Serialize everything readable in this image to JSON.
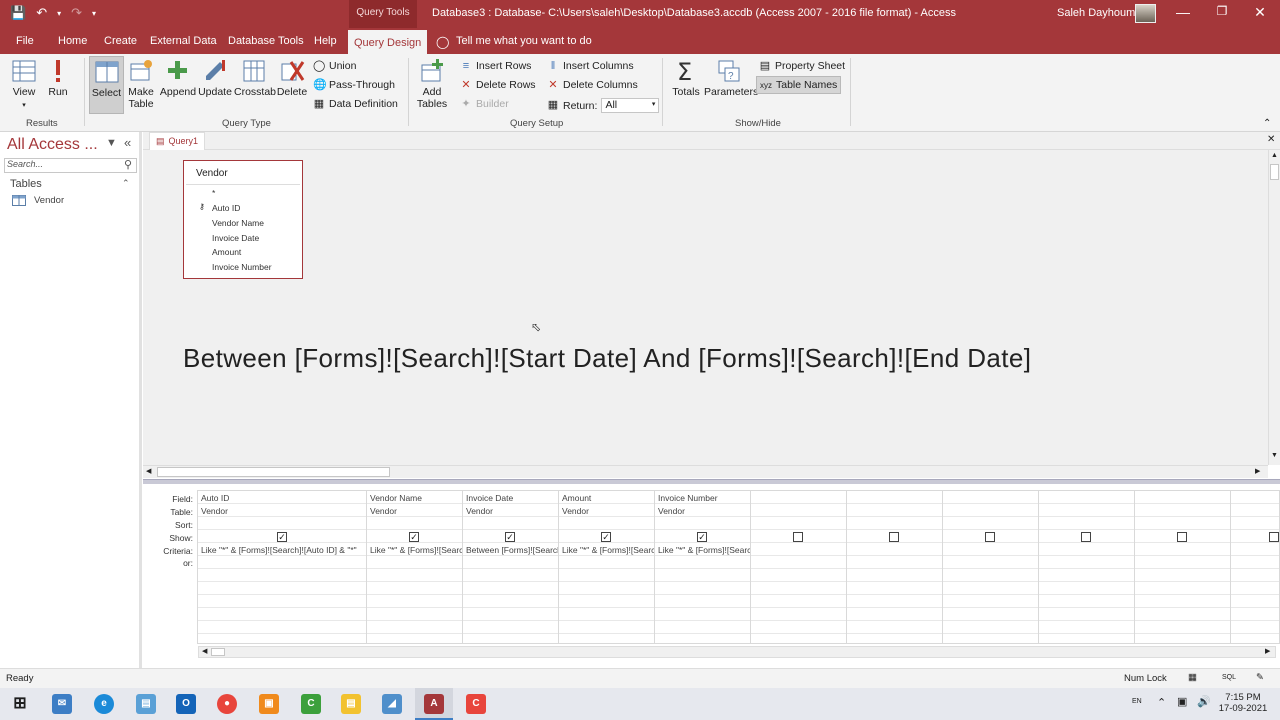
{
  "title_bar": {
    "context_tab": "Query Tools",
    "title": "Database3 : Database- C:\\Users\\saleh\\Desktop\\Database3.accdb (Access 2007 - 2016 file format)  -  Access",
    "user": "Saleh Dayhoum"
  },
  "tabs": [
    "File",
    "Home",
    "Create",
    "External Data",
    "Database Tools",
    "Help",
    "Query Design"
  ],
  "tell_me": "Tell me what you want to do",
  "ribbon": {
    "results": {
      "view": "View",
      "run": "Run",
      "group": "Results"
    },
    "query_type": {
      "select": "Select",
      "make_table_1": "Make",
      "make_table_2": "Table",
      "append": "Append",
      "update": "Update",
      "crosstab": "Crosstab",
      "delete": "Delete",
      "union": "Union",
      "pass_through": "Pass-Through",
      "data_definition": "Data Definition",
      "group": "Query Type"
    },
    "query_setup": {
      "add_tables_1": "Add",
      "add_tables_2": "Tables",
      "insert_rows": "Insert Rows",
      "delete_rows": "Delete Rows",
      "builder": "Builder",
      "insert_columns": "Insert Columns",
      "delete_columns": "Delete Columns",
      "return_label": "Return:",
      "return_value": "All",
      "group": "Query Setup"
    },
    "show_hide": {
      "totals": "Totals",
      "parameters": "Parameters",
      "property_sheet": "Property Sheet",
      "table_names": "Table Names",
      "group": "Show/Hide"
    }
  },
  "nav": {
    "title": "All Access ...",
    "search_placeholder": "Search...",
    "group": "Tables",
    "item": "Vendor"
  },
  "doc_tab": "Query1",
  "field_list": {
    "title": "Vendor",
    "fields": [
      "*",
      "Auto ID",
      "Vendor Name",
      "Invoice Date",
      "Amount",
      "Invoice Number"
    ]
  },
  "overlay_text": "Between [Forms]![Search]![Start Date] And [Forms]![Search]![End Date]",
  "grid": {
    "row_labels": [
      "Field:",
      "Table:",
      "Sort:",
      "Show:",
      "Criteria:",
      "or:"
    ],
    "columns": [
      {
        "field": "Auto ID",
        "table": "Vendor",
        "criteria": "Like \"*\" & [Forms]![Search]![Auto ID] & \"*\""
      },
      {
        "field": "Vendor Name",
        "table": "Vendor",
        "criteria": "Like \"*\" & [Forms]![Search]![Vend"
      },
      {
        "field": "Invoice Date",
        "table": "Vendor",
        "criteria": "Between [Forms]![Search]![Start D"
      },
      {
        "field": "Amount",
        "table": "Vendor",
        "criteria": "Like \"*\" & [Forms]![Search]![Amou"
      },
      {
        "field": "Invoice Number",
        "table": "Vendor",
        "criteria": "Like \"*\" & [Forms]![Search]![Invoi"
      }
    ],
    "shown": [
      true,
      true,
      true,
      true,
      true,
      false,
      false,
      false,
      false,
      false,
      false
    ]
  },
  "status": {
    "left": "Ready",
    "num_lock": "Num Lock",
    "sql": "SQL"
  },
  "clock": {
    "time": "7:15 PM",
    "date": "17-09-2021",
    "lang": "EN"
  },
  "colors": {
    "accent": "#a4373a"
  }
}
